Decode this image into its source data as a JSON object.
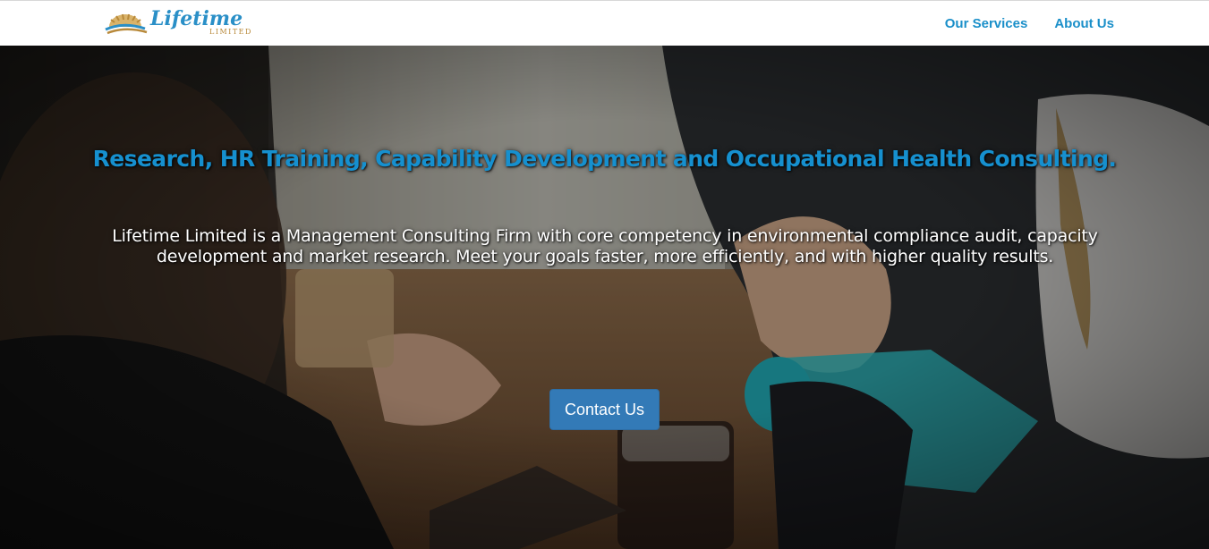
{
  "brand": {
    "logo_text": "Lifetime",
    "logo_subtext": "LIMITED"
  },
  "nav": {
    "items": [
      {
        "label": "Our Services"
      },
      {
        "label": "About Us"
      }
    ]
  },
  "hero": {
    "title": "Research, HR Training, Capability Development and Occupational Health Consulting.",
    "description": "Lifetime Limited is a Management Consulting Firm with core competency in environmental compliance audit, capacity development and market research. Meet your goals faster, more efficiently, and with higher quality results.",
    "cta_label": "Contact Us"
  },
  "colors": {
    "accent": "#1a8fc9",
    "button": "#337ab7",
    "logo_gold": "#b8893a",
    "logo_blue": "#2a8fc7"
  },
  "icons": [
    "sun-logo-icon"
  ]
}
